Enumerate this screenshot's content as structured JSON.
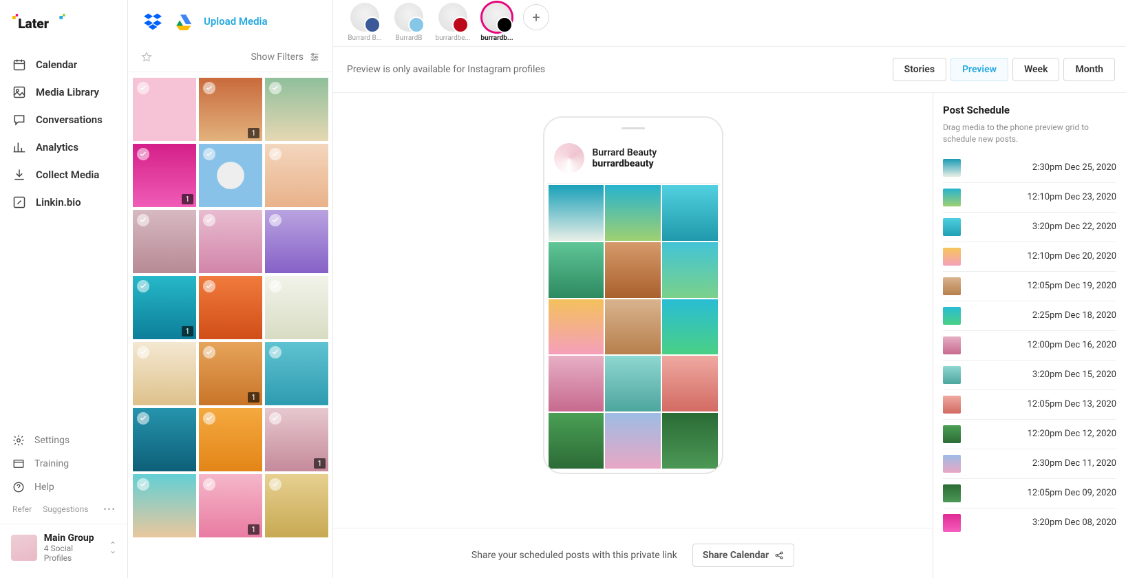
{
  "sidebar": {
    "nav": [
      {
        "id": "calendar",
        "label": "Calendar"
      },
      {
        "id": "media-library",
        "label": "Media Library"
      },
      {
        "id": "conversations",
        "label": "Conversations"
      },
      {
        "id": "analytics",
        "label": "Analytics"
      },
      {
        "id": "collect-media",
        "label": "Collect Media"
      },
      {
        "id": "linkinbio",
        "label": "Linkin.bio"
      }
    ],
    "footer": [
      {
        "id": "settings",
        "label": "Settings"
      },
      {
        "id": "training",
        "label": "Training"
      },
      {
        "id": "help",
        "label": "Help"
      }
    ],
    "refer_label": "Refer",
    "suggestions_label": "Suggestions",
    "group": {
      "title": "Main Group",
      "subtitle": "4 Social Profiles"
    }
  },
  "media": {
    "upload_label": "Upload Media",
    "show_filters_label": "Show Filters",
    "tiles": [
      {
        "bg": "linear-gradient(#f6c2d5,#f6c2d5)",
        "count": null
      },
      {
        "bg": "linear-gradient(#c96a3c,#e2b27d)",
        "count": "1"
      },
      {
        "bg": "linear-gradient(#8fbf9b,#e6d8b3)",
        "count": null
      },
      {
        "bg": "linear-gradient(#d41f88,#f05cb7)",
        "count": "1"
      },
      {
        "bg": "radial-gradient(circle,#eee 30%,#89c2e8 31%)",
        "count": null
      },
      {
        "bg": "linear-gradient(#f3d6bd,#e9b28a)",
        "count": null
      },
      {
        "bg": "linear-gradient(#d7b9c2,#b78a94)",
        "count": null
      },
      {
        "bg": "linear-gradient(#e8bcd0,#d285a9)",
        "count": null
      },
      {
        "bg": "linear-gradient(#b9a3e0,#8661c7)",
        "count": null
      },
      {
        "bg": "linear-gradient(#26b8c9,#0d7e9a)",
        "count": "1"
      },
      {
        "bg": "linear-gradient(#f07b3c,#d14e18)",
        "count": null
      },
      {
        "bg": "linear-gradient(#f2f3ea,#d8dcc3)",
        "count": null
      },
      {
        "bg": "linear-gradient(#f4e8d2,#dec18b)",
        "count": null
      },
      {
        "bg": "linear-gradient(#e6a45a,#c97528)",
        "count": "1"
      },
      {
        "bg": "linear-gradient(#5fc3d1,#2e9bb0)",
        "count": null
      },
      {
        "bg": "linear-gradient(#2694ad,#0d5f77)",
        "count": null
      },
      {
        "bg": "linear-gradient(#f4a93f,#e38518)",
        "count": null
      },
      {
        "bg": "linear-gradient(#e7c8cf,#c58a9a)",
        "count": "1"
      },
      {
        "bg": "linear-gradient(#63cfd5,#e9c79c)",
        "count": null
      },
      {
        "bg": "linear-gradient(#f5b7c9,#e97ba2)",
        "count": "1"
      },
      {
        "bg": "linear-gradient(#e7d091,#c7a952)",
        "count": null
      }
    ]
  },
  "profiles": {
    "items": [
      {
        "id": "fb",
        "label": "Burrard B...",
        "type": "fb"
      },
      {
        "id": "tw",
        "label": "BurrardB",
        "type": "tw"
      },
      {
        "id": "pn",
        "label": "burrardbe...",
        "type": "pn"
      },
      {
        "id": "ig",
        "label": "burrardb...",
        "type": "ig",
        "selected": true
      }
    ]
  },
  "mainbar": {
    "note": "Preview is only available for Instagram profiles",
    "buttons": [
      {
        "id": "stories",
        "label": "Stories"
      },
      {
        "id": "preview",
        "label": "Preview",
        "active": true
      },
      {
        "id": "week",
        "label": "Week"
      },
      {
        "id": "month",
        "label": "Month"
      }
    ]
  },
  "phone": {
    "display_name": "Burrard Beauty",
    "handle": "burrardbeauty",
    "grid": [
      "linear-gradient(#19a0b8,#e8eee6)",
      "linear-gradient(#27b3ce,#9fd071)",
      "linear-gradient(#52d1e0,#1f99ab)",
      "linear-gradient(#5fc597,#2d8a60)",
      "linear-gradient(#d69a6a,#a9602d)",
      "linear-gradient(#42c4d6,#7bd18a)",
      "linear-gradient(#f3c15c,#f59fba)",
      "linear-gradient(#d9b38e,#b77f4c)",
      "linear-gradient(#29bdd4,#4ad085)",
      "linear-gradient(#e7afc4,#c76a8f)",
      "linear-gradient(#8fd7d1,#4da69e)",
      "linear-gradient(#efa9a1,#d26b63)",
      "linear-gradient(#4a9f55,#2c6b36)",
      "linear-gradient(#9dbce5,#e8a7c4)",
      "linear-gradient(#2a6b35,#4c9856)",
      "linear-gradient(#e22a95,#f35fbc)",
      "linear-gradient(#8a8d91,#c9cacc)",
      "linear-gradient(#d9b892,#f2e3cc)"
    ]
  },
  "share": {
    "text": "Share your scheduled posts with this private link",
    "button": "Share Calendar"
  },
  "schedule": {
    "title": "Post Schedule",
    "hint": "Drag media to the phone preview grid to schedule new posts.",
    "items": [
      {
        "time": "2:30pm Dec 25, 2020",
        "bg": "linear-gradient(#1a9bb3,#e9efe6)"
      },
      {
        "time": "12:10pm Dec 23, 2020",
        "bg": "linear-gradient(#28b3ce,#9fd071)"
      },
      {
        "time": "3:20pm Dec 22, 2020",
        "bg": "linear-gradient(#4ecfdf,#20a0b3)"
      },
      {
        "time": "12:10pm Dec 20, 2020",
        "bg": "linear-gradient(#f6c65a,#f59fba)"
      },
      {
        "time": "12:05pm Dec 19, 2020",
        "bg": "linear-gradient(#d9b38e,#b77f4c)"
      },
      {
        "time": "2:25pm Dec 18, 2020",
        "bg": "linear-gradient(#29bdd4,#4ad085)"
      },
      {
        "time": "12:00pm Dec 16, 2020",
        "bg": "linear-gradient(#e7afc4,#c76a8f)"
      },
      {
        "time": "3:20pm Dec 15, 2020",
        "bg": "linear-gradient(#8fd7d1,#4da69e)"
      },
      {
        "time": "12:05pm Dec 13, 2020",
        "bg": "linear-gradient(#efa9a1,#d26b63)"
      },
      {
        "time": "12:20pm Dec 12, 2020",
        "bg": "linear-gradient(#4a9f55,#2c6b36)"
      },
      {
        "time": "2:30pm Dec 11, 2020",
        "bg": "linear-gradient(#9dbce5,#e8a7c4)"
      },
      {
        "time": "12:05pm Dec 09, 2020",
        "bg": "linear-gradient(#2a6b35,#4c9856)"
      },
      {
        "time": "3:20pm Dec 08, 2020",
        "bg": "linear-gradient(#e22a95,#f35fbc)"
      }
    ]
  }
}
